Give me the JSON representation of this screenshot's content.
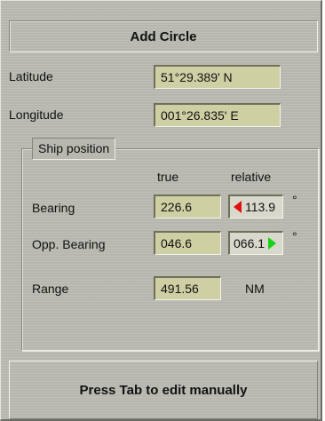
{
  "dialog": {
    "title": "Add Circle",
    "latitude_label": "Latitude",
    "latitude_value": "51°29.389' N",
    "longitude_label": "Longitude",
    "longitude_value": "001°26.835' E"
  },
  "ship_position": {
    "group_label": "Ship position",
    "col_true": "true",
    "col_relative": "relative",
    "bearing_label": "Bearing",
    "bearing_true": "226.6",
    "bearing_relative": "113.9",
    "opp_bearing_label": "Opp. Bearing",
    "opp_bearing_true": "046.6",
    "opp_bearing_relative": "066.1",
    "degree_symbol": "°",
    "range_label": "Range",
    "range_value": "491.56",
    "range_unit": "NM"
  },
  "footer": {
    "hint": "Press Tab to edit manually"
  },
  "colors": {
    "panel": "#b8b8b0",
    "field": "#cfcfa4",
    "arrow_left": "#e01010",
    "arrow_right": "#18d018"
  }
}
